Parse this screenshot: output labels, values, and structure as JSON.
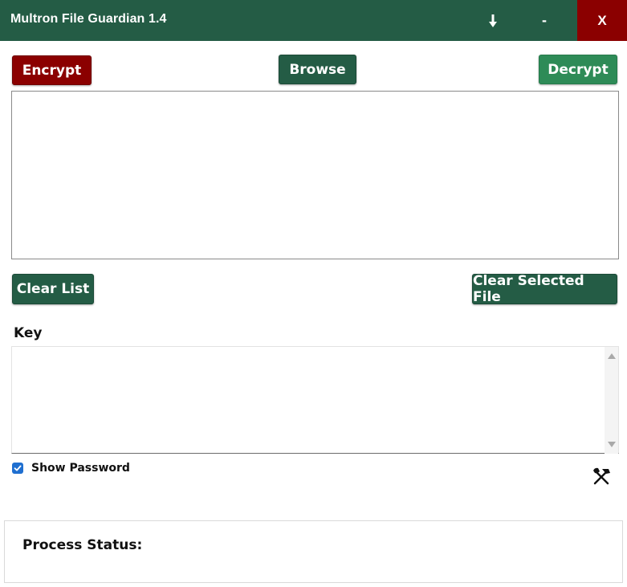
{
  "window": {
    "title": "Multron File Guardian 1.4",
    "pin_glyph": "⬇",
    "minimize_glyph": "-",
    "close_glyph": "X"
  },
  "actions": {
    "encrypt_label": "Encrypt",
    "browse_label": "Browse",
    "decrypt_label": "Decrypt",
    "clear_list_label": "Clear List",
    "clear_selected_label": "Clear Selected File"
  },
  "file_list": {
    "items": []
  },
  "key": {
    "label": "Key",
    "value": ""
  },
  "show_password": {
    "label": "Show Password",
    "checked": true
  },
  "tools": {
    "icon": "tools-icon"
  },
  "status": {
    "label": "Process Status:"
  },
  "colors": {
    "primary_green": "#245c45",
    "light_green": "#2e8b57",
    "danger_red": "#8b0000",
    "checkbox_blue": "#1f6fd0"
  }
}
